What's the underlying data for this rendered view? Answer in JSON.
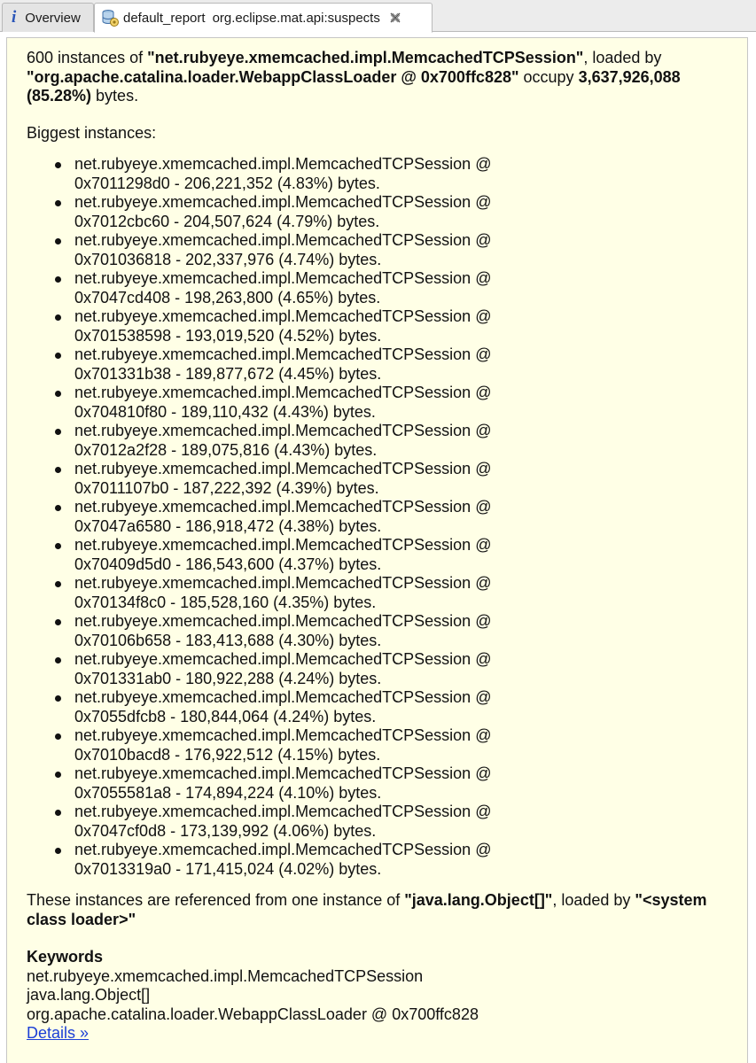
{
  "tabs": {
    "overview_label": "Overview",
    "report_title": "default_report",
    "report_subtitle": "org.eclipse.mat.api:suspects"
  },
  "summary": {
    "count_text": "600 instances of ",
    "class_name": "\"net.rubyeye.xmemcached.impl.MemcachedTCPSession\"",
    "loaded_by_text": ", loaded by ",
    "loader_name": "\"org.apache.catalina.loader.WebappClassLoader @ 0x700ffc828\"",
    "occupy_text": " occupy ",
    "total_bytes": "3,637,926,088 (85.28%)",
    "bytes_text": " bytes."
  },
  "biggest_heading": "Biggest instances:",
  "instances": [
    {
      "class": "net.rubyeye.xmemcached.impl.MemcachedTCPSession @",
      "detail": "0x7011298d0 - 206,221,352 (4.83%) bytes."
    },
    {
      "class": "net.rubyeye.xmemcached.impl.MemcachedTCPSession @",
      "detail": "0x7012cbc60 - 204,507,624 (4.79%) bytes."
    },
    {
      "class": "net.rubyeye.xmemcached.impl.MemcachedTCPSession @",
      "detail": "0x701036818 - 202,337,976 (4.74%) bytes."
    },
    {
      "class": "net.rubyeye.xmemcached.impl.MemcachedTCPSession @",
      "detail": "0x7047cd408 - 198,263,800 (4.65%) bytes."
    },
    {
      "class": "net.rubyeye.xmemcached.impl.MemcachedTCPSession @",
      "detail": "0x701538598 - 193,019,520 (4.52%) bytes."
    },
    {
      "class": "net.rubyeye.xmemcached.impl.MemcachedTCPSession @",
      "detail": "0x701331b38 - 189,877,672 (4.45%) bytes."
    },
    {
      "class": "net.rubyeye.xmemcached.impl.MemcachedTCPSession @",
      "detail": "0x704810f80 - 189,110,432 (4.43%) bytes."
    },
    {
      "class": "net.rubyeye.xmemcached.impl.MemcachedTCPSession @",
      "detail": "0x7012a2f28 - 189,075,816 (4.43%) bytes."
    },
    {
      "class": "net.rubyeye.xmemcached.impl.MemcachedTCPSession @",
      "detail": "0x7011107b0 - 187,222,392 (4.39%) bytes."
    },
    {
      "class": "net.rubyeye.xmemcached.impl.MemcachedTCPSession @",
      "detail": "0x7047a6580 - 186,918,472 (4.38%) bytes."
    },
    {
      "class": "net.rubyeye.xmemcached.impl.MemcachedTCPSession @",
      "detail": "0x70409d5d0 - 186,543,600 (4.37%) bytes."
    },
    {
      "class": "net.rubyeye.xmemcached.impl.MemcachedTCPSession @",
      "detail": "0x70134f8c0 - 185,528,160 (4.35%) bytes."
    },
    {
      "class": "net.rubyeye.xmemcached.impl.MemcachedTCPSession @",
      "detail": "0x70106b658 - 183,413,688 (4.30%) bytes."
    },
    {
      "class": "net.rubyeye.xmemcached.impl.MemcachedTCPSession @",
      "detail": "0x701331ab0 - 180,922,288 (4.24%) bytes."
    },
    {
      "class": "net.rubyeye.xmemcached.impl.MemcachedTCPSession @",
      "detail": "0x7055dfcb8 - 180,844,064 (4.24%) bytes."
    },
    {
      "class": "net.rubyeye.xmemcached.impl.MemcachedTCPSession @",
      "detail": "0x7010bacd8 - 176,922,512 (4.15%) bytes."
    },
    {
      "class": "net.rubyeye.xmemcached.impl.MemcachedTCPSession @",
      "detail": "0x7055581a8 - 174,894,224 (4.10%) bytes."
    },
    {
      "class": "net.rubyeye.xmemcached.impl.MemcachedTCPSession @",
      "detail": "0x7047cf0d8 - 173,139,992 (4.06%) bytes."
    },
    {
      "class": "net.rubyeye.xmemcached.impl.MemcachedTCPSession @",
      "detail": "0x7013319a0 - 171,415,024 (4.02%) bytes."
    }
  ],
  "references": {
    "prefix": "These instances are referenced from one instance of ",
    "referrer_class": "\"java.lang.Object[]\"",
    "loaded_by_text": ", loaded by ",
    "referrer_loader": "\"<system class loader>\""
  },
  "keywords": {
    "title": "Keywords",
    "items": [
      "net.rubyeye.xmemcached.impl.MemcachedTCPSession",
      "java.lang.Object[]",
      "org.apache.catalina.loader.WebappClassLoader @ 0x700ffc828"
    ],
    "details_link": "Details »"
  },
  "colors": {
    "panel_background": "#ffffe6",
    "link": "#1b3fd6",
    "info_icon": "#2a55b8"
  },
  "icons": [
    "info-icon",
    "report-icon",
    "close-icon"
  ]
}
